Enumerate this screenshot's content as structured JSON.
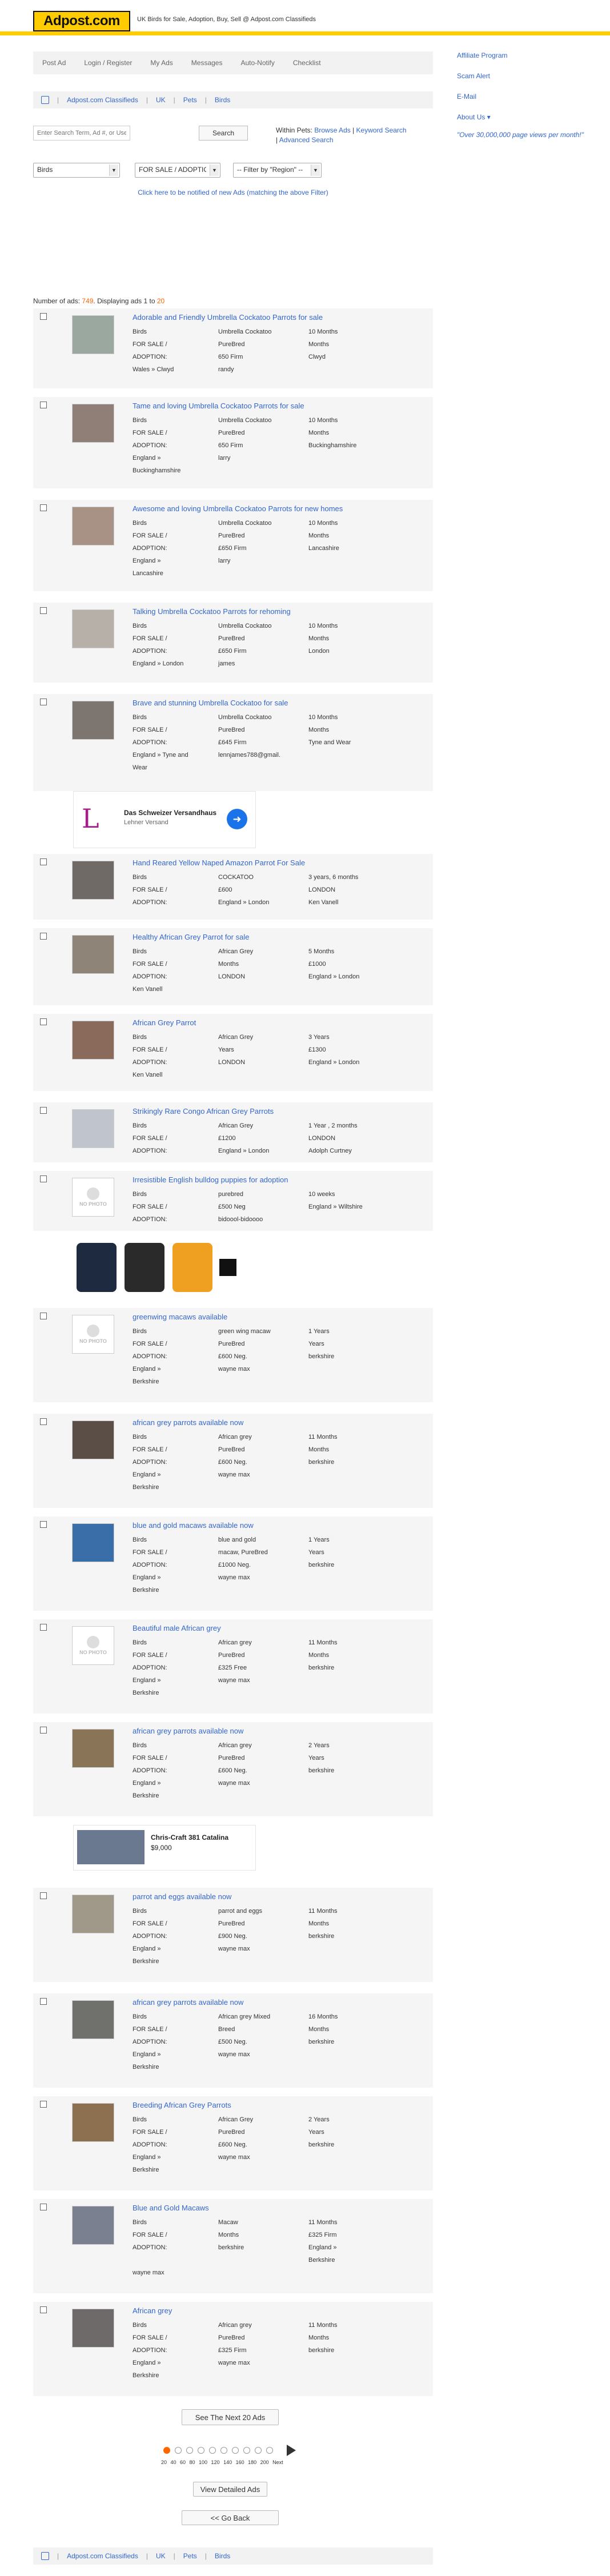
{
  "header": {
    "logo": "Adpost.com",
    "tagline": "UK Birds for Sale, Adoption, Buy, Sell @ Adpost.com Classifieds"
  },
  "nav": [
    "Post Ad",
    "Login / Register",
    "My Ads",
    "Messages",
    "Auto-Notify",
    "Checklist"
  ],
  "breadcrumb": [
    "Adpost.com Classifieds",
    "UK",
    "Pets",
    "Birds"
  ],
  "search": {
    "placeholder": "Enter Search Term, Ad #, or Username",
    "button": "Search",
    "within_label": "Within Pets:",
    "links": [
      "Browse Ads",
      "Keyword Search",
      "Advanced Search"
    ]
  },
  "filters": {
    "category": "Birds",
    "type": "FOR SALE / ADOPTION",
    "region": "-- Filter by \"Region\" --"
  },
  "notify_link": "Click here to be notified of new Ads (matching the above Filter)",
  "sidebar": {
    "links": [
      "Affiliate Program",
      "Scam Alert",
      "E-Mail",
      "About Us ▾"
    ],
    "quote": "\"Over 30,000,000 page views per month!\""
  },
  "results": {
    "prefix": "Number of ads:",
    "total": "749",
    "mid": ". Displaying ads",
    "from": "1",
    "to_word": "to",
    "to": "20"
  },
  "listings": [
    {
      "title": "Adorable and Friendly Umbrella Cockatoo Parrots for sale",
      "thumb": "#9aa8a0",
      "cells": [
        "Birds",
        "Umbrella Cockatoo",
        "10 Months",
        "FOR SALE /",
        "PureBred",
        "Months",
        "ADOPTION:",
        "650 Firm",
        "Clwyd",
        "Wales » Clwyd",
        "randy",
        ""
      ]
    },
    {
      "title": "Tame and loving Umbrella Cockatoo Parrots for sale",
      "thumb": "#8f7f76",
      "cells": [
        "Birds",
        "Umbrella Cockatoo",
        "10 Months",
        "FOR SALE /",
        "PureBred",
        "Months",
        "ADOPTION:",
        "650 Firm",
        "Buckinghamshire",
        "England »",
        "larry",
        "",
        "Buckinghamshire",
        "",
        ""
      ]
    },
    {
      "title": "Awesome and loving Umbrella Cockatoo Parrots for new homes",
      "thumb": "#a89286",
      "cells": [
        "Birds",
        "Umbrella Cockatoo",
        "10 Months",
        "FOR SALE /",
        "PureBred",
        "Months",
        "ADOPTION:",
        "£650 Firm",
        "Lancashire",
        "England »",
        "larry",
        "",
        "Lancashire",
        "",
        ""
      ]
    },
    {
      "title": "Talking Umbrella Cockatoo Parrots for rehoming",
      "thumb": "#b6b0a8",
      "cells": [
        "Birds",
        "Umbrella Cockatoo",
        "10 Months",
        "FOR SALE /",
        "PureBred",
        "Months",
        "ADOPTION:",
        "£650 Firm",
        "London",
        "England » London",
        "james",
        ""
      ]
    },
    {
      "title": "Brave and stunning Umbrella Cockatoo for sale",
      "thumb": "#7d7670",
      "cells": [
        "Birds",
        "Umbrella Cockatoo",
        "10 Months",
        "FOR SALE /",
        "PureBred",
        "Months",
        "ADOPTION:",
        "£645 Firm",
        "Tyne and Wear",
        "England » Tyne and",
        "lennjames788@gmail.",
        "",
        "Wear",
        "",
        ""
      ]
    },
    {
      "title": "Hand Reared Yellow Naped Amazon Parrot For Sale",
      "thumb": "#6f6a66",
      "cells": [
        "Birds",
        "COCKATOO",
        "3 years, 6 months",
        "FOR SALE /",
        "£600",
        "LONDON",
        "ADOPTION:",
        "England » London",
        "Ken Vanell"
      ]
    },
    {
      "title": "Healthy African Grey Parrot for sale",
      "thumb": "#8e8478",
      "cells": [
        "Birds",
        "African Grey",
        "5 Months",
        "FOR SALE /",
        "Months",
        "£1000",
        "ADOPTION:",
        "LONDON",
        "England » London",
        "Ken Vanell",
        "",
        ""
      ]
    },
    {
      "title": "African Grey Parrot",
      "thumb": "#8a6a5a",
      "cells": [
        "Birds",
        "African Grey",
        "3 Years",
        "FOR SALE /",
        "Years",
        "£1300",
        "ADOPTION:",
        "LONDON",
        "England » London",
        "Ken Vanell",
        "",
        ""
      ]
    },
    {
      "title": "Strikingly Rare Congo African Grey Parrots",
      "thumb": "#c0c4cc",
      "cells": [
        "Birds",
        "African Grey",
        "1 Year , 2 months",
        "FOR SALE /",
        "£1200",
        "LONDON",
        "ADOPTION:",
        "England » London",
        "Adolph Curtney"
      ]
    },
    {
      "title": "Irresistible English bulldog puppies for adoption",
      "thumb": "nophoto",
      "cells": [
        "Birds",
        "purebred",
        "10 weeks",
        "FOR SALE /",
        "£500 Neg",
        "England » Wiltshire",
        "ADOPTION:",
        "bidoool-bidoooo",
        ""
      ]
    },
    {
      "title": "greenwing macaws available",
      "thumb": "nophoto",
      "cells": [
        "Birds",
        "green wing macaw",
        "1 Years",
        "FOR SALE /",
        "PureBred",
        "Years",
        "ADOPTION:",
        "£600 Neg.",
        "berkshire",
        "England »",
        "wayne max",
        "",
        "Berkshire",
        "",
        ""
      ]
    },
    {
      "title": "african grey parrots available now",
      "thumb": "#5a4e46",
      "cells": [
        "Birds",
        "African grey",
        "11 Months",
        "FOR SALE /",
        "PureBred",
        "Months",
        "ADOPTION:",
        "£600 Neg.",
        "berkshire",
        "England »",
        "wayne max",
        "",
        "Berkshire",
        "",
        ""
      ]
    },
    {
      "title": "blue and gold macaws available now",
      "thumb": "#3a6ea8",
      "cells": [
        "Birds",
        "blue and gold",
        "1 Years",
        "FOR SALE /",
        "macaw, PureBred",
        "Years",
        "ADOPTION:",
        "£1000 Neg.",
        "berkshire",
        "England »",
        "wayne max",
        "",
        "Berkshire",
        "",
        ""
      ]
    },
    {
      "title": "Beautiful male African grey",
      "thumb": "nophoto",
      "cells": [
        "Birds",
        "African grey",
        "11 Months",
        "FOR SALE /",
        "PureBred",
        "Months",
        "ADOPTION:",
        "£325 Free",
        "berkshire",
        "England »",
        "wayne max",
        "",
        "Berkshire",
        "",
        ""
      ]
    },
    {
      "title": "african grey parrots available now",
      "thumb": "#8a7458",
      "cells": [
        "Birds",
        "African grey",
        "2 Years",
        "FOR SALE /",
        "PureBred",
        "Years",
        "ADOPTION:",
        "£600 Neg.",
        "berkshire",
        "England »",
        "wayne max",
        "",
        "Berkshire",
        "",
        ""
      ]
    },
    {
      "title": "parrot and eggs available now",
      "thumb": "#a09888",
      "cells": [
        "Birds",
        "parrot and eggs",
        "11 Months",
        "FOR SALE /",
        "PureBred",
        "Months",
        "ADOPTION:",
        "£900 Neg.",
        "berkshire",
        "England »",
        "wayne max",
        "",
        "Berkshire",
        "",
        ""
      ]
    },
    {
      "title": "african grey parrots available now",
      "thumb": "#70706c",
      "cells": [
        "Birds",
        "African grey Mixed",
        "16 Months",
        "FOR SALE /",
        "Breed",
        "Months",
        "ADOPTION:",
        "£500 Neg.",
        "berkshire",
        "England »",
        "wayne max",
        "",
        "Berkshire",
        "",
        ""
      ]
    },
    {
      "title": "Breeding African Grey Parrots",
      "thumb": "#8c7050",
      "cells": [
        "Birds",
        "African Grey",
        "2 Years",
        "FOR SALE /",
        "PureBred",
        "Years",
        "ADOPTION:",
        "£600 Neg.",
        "berkshire",
        "England »",
        "wayne max",
        "",
        "Berkshire",
        "",
        ""
      ]
    },
    {
      "title": "Blue and Gold Macaws",
      "thumb": "#7a8090",
      "cells": [
        "Birds",
        "Macaw",
        "11 Months",
        "FOR SALE /",
        "Months",
        "£325 Firm",
        "ADOPTION:",
        "berkshire",
        "England »",
        "",
        "",
        "Berkshire",
        "wayne max",
        "",
        ""
      ]
    },
    {
      "title": "African grey",
      "thumb": "#6e6a6a",
      "cells": [
        "Birds",
        "African grey",
        "11 Months",
        "FOR SALE /",
        "PureBred",
        "Months",
        "ADOPTION:",
        "£325 Firm",
        "berkshire",
        "England »",
        "wayne max",
        "",
        "Berkshire",
        "",
        ""
      ]
    }
  ],
  "ads": {
    "ad1_title": "Das Schweizer Versandhaus",
    "ad1_sub": "Lehner Versand",
    "ad1_logo": "L",
    "ad3_title": "Chris-Craft 381 Catalina",
    "ad3_price": "$9,000"
  },
  "buttons": {
    "next": "See The Next 20 Ads",
    "detailed": "View Detailed Ads",
    "back": "<< Go Back"
  },
  "pager_labels": "20 40 60 80 100 120 140 160 180 200 Next"
}
